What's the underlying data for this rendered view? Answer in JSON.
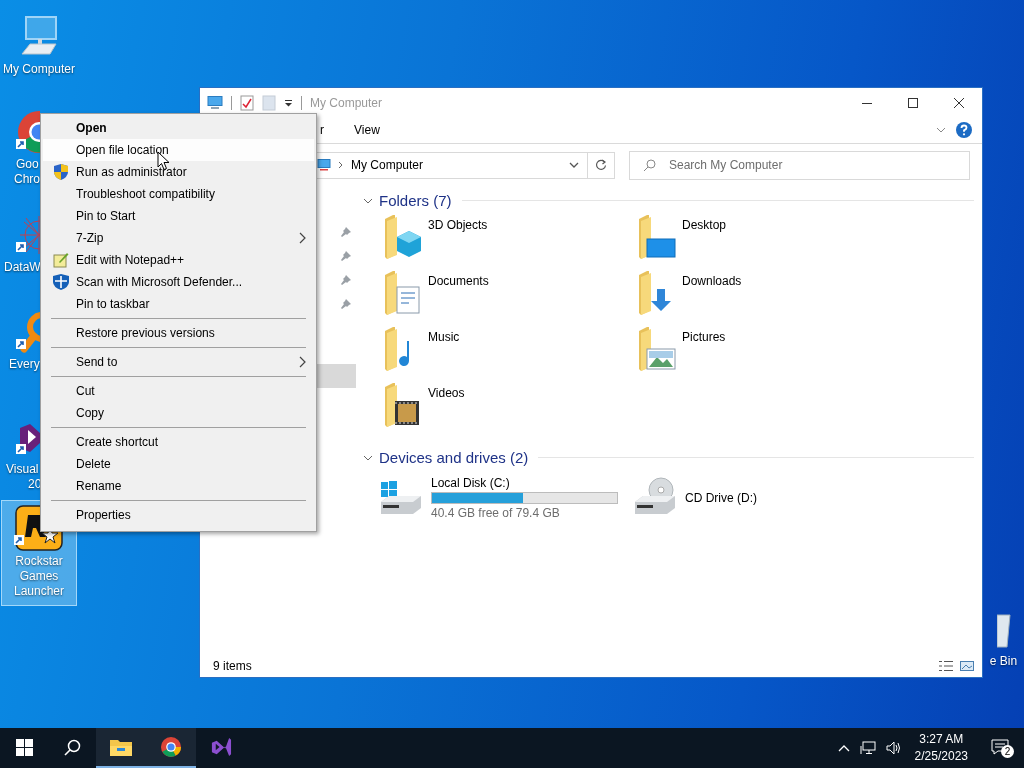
{
  "desktop_icons": [
    {
      "lines": [
        "My Computer"
      ],
      "selected": false
    },
    {
      "lines": [
        "Goo",
        "Chro"
      ],
      "selected": false
    },
    {
      "lines": [
        "DataW"
      ],
      "selected": false
    },
    {
      "lines": [
        "Every"
      ],
      "selected": false
    },
    {
      "lines": [
        "Visual",
        "20"
      ],
      "selected": false
    },
    {
      "lines": [
        "Rockstar",
        "Games",
        "Launcher"
      ],
      "selected": true
    },
    {
      "lines": [
        "e Bin"
      ],
      "selected": false
    }
  ],
  "explorer": {
    "title": "My Computer",
    "ribbon_tabs": [
      {
        "label": "r"
      },
      {
        "label": "View"
      }
    ],
    "address": "My Computer",
    "search": {
      "placeholder": "Search My Computer"
    },
    "nav_pane": [
      {
        "pinned": true,
        "selected": false
      },
      {
        "pinned": true,
        "selected": false
      },
      {
        "pinned": true,
        "selected": false
      },
      {
        "pinned": true,
        "selected": false
      },
      {
        "pinned": false,
        "selected": false
      },
      {
        "pinned": false,
        "selected": false
      },
      {
        "pinned": false,
        "selected": true
      }
    ],
    "folders": {
      "heading": "Folders (7)",
      "expanded": true,
      "items": [
        "3D Objects",
        "Desktop",
        "Documents",
        "Downloads",
        "Music",
        "Pictures",
        "Videos"
      ]
    },
    "drives": {
      "heading": "Devices and drives (2)",
      "expanded": true,
      "items": [
        {
          "name": "Local Disk (C:)",
          "level": 0.49,
          "free": "40.4 GB free of 79.4 GB"
        },
        {
          "name": "CD Drive (D:)"
        }
      ]
    },
    "status_bar": "9 items"
  },
  "context_menu": {
    "items": [
      {
        "label": "Open",
        "default": true,
        "highlighted": false,
        "submenu": false,
        "separator_before": false
      },
      {
        "label": "Open file location",
        "default": false,
        "highlighted": true,
        "submenu": false,
        "separator_before": false
      },
      {
        "label": "Run as administrator",
        "default": false,
        "highlighted": false,
        "submenu": false,
        "separator_before": false
      },
      {
        "label": "Troubleshoot compatibility",
        "default": false,
        "highlighted": false,
        "submenu": false,
        "separator_before": false
      },
      {
        "label": "Pin to Start",
        "default": false,
        "highlighted": false,
        "submenu": false,
        "separator_before": false
      },
      {
        "label": "7-Zip",
        "default": false,
        "highlighted": false,
        "submenu": true,
        "separator_before": false
      },
      {
        "label": "Edit with Notepad++",
        "default": false,
        "highlighted": false,
        "submenu": false,
        "separator_before": false
      },
      {
        "label": "Scan with Microsoft Defender...",
        "default": false,
        "highlighted": false,
        "submenu": false,
        "separator_before": false
      },
      {
        "label": "Pin to taskbar",
        "default": false,
        "highlighted": false,
        "submenu": false,
        "separator_before": false
      },
      {
        "label": "Restore previous versions",
        "default": false,
        "highlighted": false,
        "submenu": false,
        "separator_before": true
      },
      {
        "label": "Send to",
        "default": false,
        "highlighted": false,
        "submenu": true,
        "separator_before": true
      },
      {
        "label": "Cut",
        "default": false,
        "highlighted": false,
        "submenu": false,
        "separator_before": true
      },
      {
        "label": "Copy",
        "default": false,
        "highlighted": false,
        "submenu": false,
        "separator_before": false
      },
      {
        "label": "Create shortcut",
        "default": false,
        "highlighted": false,
        "submenu": false,
        "separator_before": true
      },
      {
        "label": "Delete",
        "default": false,
        "highlighted": false,
        "submenu": false,
        "separator_before": false
      },
      {
        "label": "Rename",
        "default": false,
        "highlighted": false,
        "submenu": false,
        "separator_before": false
      },
      {
        "label": "Properties",
        "default": false,
        "highlighted": false,
        "submenu": false,
        "separator_before": true
      }
    ]
  },
  "taskbar": {
    "apps": [
      {
        "running": true
      },
      {
        "running": true
      },
      {
        "running": false
      }
    ],
    "time": "3:27 AM",
    "date": "2/25/2023",
    "notifications": "2"
  }
}
